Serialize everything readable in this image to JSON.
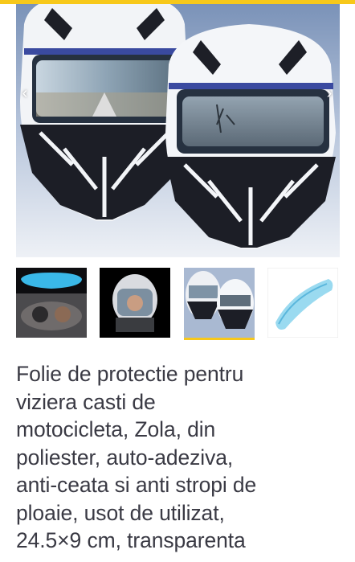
{
  "colors": {
    "accent": "#f7c81a",
    "selected_thumb_underline": "#f7c81a",
    "title_text": "#3a3a44"
  },
  "gallery": {
    "prev_icon": "chevron-left-icon",
    "next_icon": "chevron-right-icon",
    "prev_glyph": "‹",
    "next_glyph": "›",
    "selected_index": 2,
    "thumbnail_count": 4
  },
  "product": {
    "title": "Folie de protectie pentru\nviziera casti de\nmotocicleta, Zola, din\npoliester, auto-adeziva,\nanti-ceata si anti stropi de\nploaie, usot de utilizat,\n24.5×9 cm, transparenta"
  }
}
